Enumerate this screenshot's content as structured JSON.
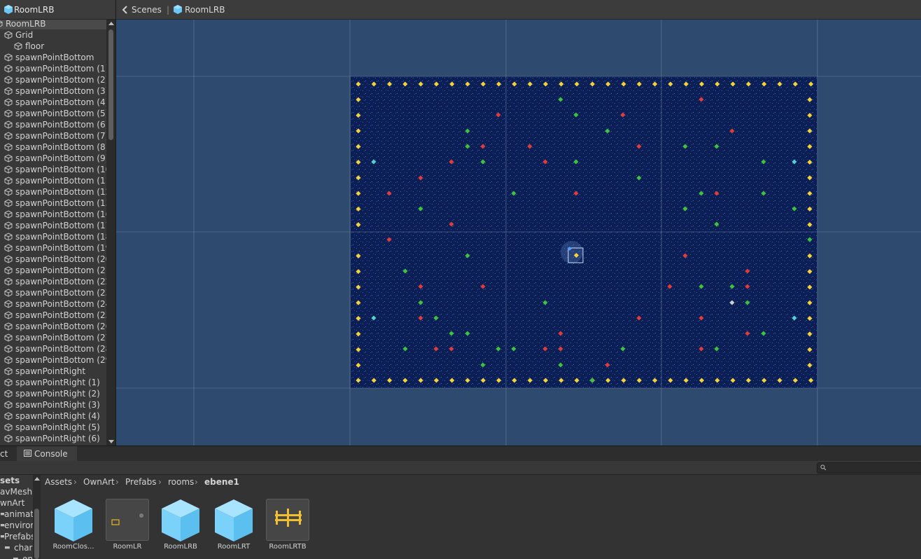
{
  "hierarchy": {
    "title": "RoomLRB",
    "root": "RoomLRB",
    "items": [
      "Grid",
      "floor",
      "spawnPointBottom",
      "spawnPointBottom (1)",
      "spawnPointBottom (2)",
      "spawnPointBottom (3)",
      "spawnPointBottom (4)",
      "spawnPointBottom (5)",
      "spawnPointBottom (6)",
      "spawnPointBottom (7)",
      "spawnPointBottom (8)",
      "spawnPointBottom (9)",
      "spawnPointBottom (10",
      "spawnPointBottom (11)",
      "spawnPointBottom (12",
      "spawnPointBottom (13",
      "spawnPointBottom (16",
      "spawnPointBottom (17",
      "spawnPointBottom (18",
      "spawnPointBottom (19",
      "spawnPointBottom (20",
      "spawnPointBottom (21",
      "spawnPointBottom (22",
      "spawnPointBottom (23",
      "spawnPointBottom (24",
      "spawnPointBottom (25",
      "spawnPointBottom (26",
      "spawnPointBottom (27",
      "spawnPointBottom (28",
      "spawnPointBottom (29",
      "spawnPointRight",
      "spawnPointRight (1)",
      "spawnPointRight (2)",
      "spawnPointRight (3)",
      "spawnPointRight (4)",
      "spawnPointRight (5)",
      "spawnPointRight (6)"
    ]
  },
  "scene": {
    "breadcrumb_scenes": "Scenes",
    "breadcrumb_prefab": "RoomLRB",
    "background_color": "#2e4a6e",
    "room_color": "#0c1f55"
  },
  "bottom": {
    "tab_project": "ct",
    "tab_console": "Console",
    "folders": [
      "sets",
      "avMesh",
      "wnArt",
      "animat",
      "enviror",
      "Prefabs",
      "char",
      "en"
    ],
    "breadcrumb": [
      "Assets",
      "OwnArt",
      "Prefabs",
      "rooms",
      "ebene1"
    ],
    "assets": [
      {
        "name": "RoomClos...",
        "icon": "prefab-cube-icon"
      },
      {
        "name": "RoomLR",
        "icon": "room-thumbnail-icon"
      },
      {
        "name": "RoomLRB",
        "icon": "prefab-cube-icon"
      },
      {
        "name": "RoomLRT",
        "icon": "prefab-cube-icon"
      },
      {
        "name": "RoomLRTB",
        "icon": "room-thumbnail-icon"
      }
    ]
  }
}
